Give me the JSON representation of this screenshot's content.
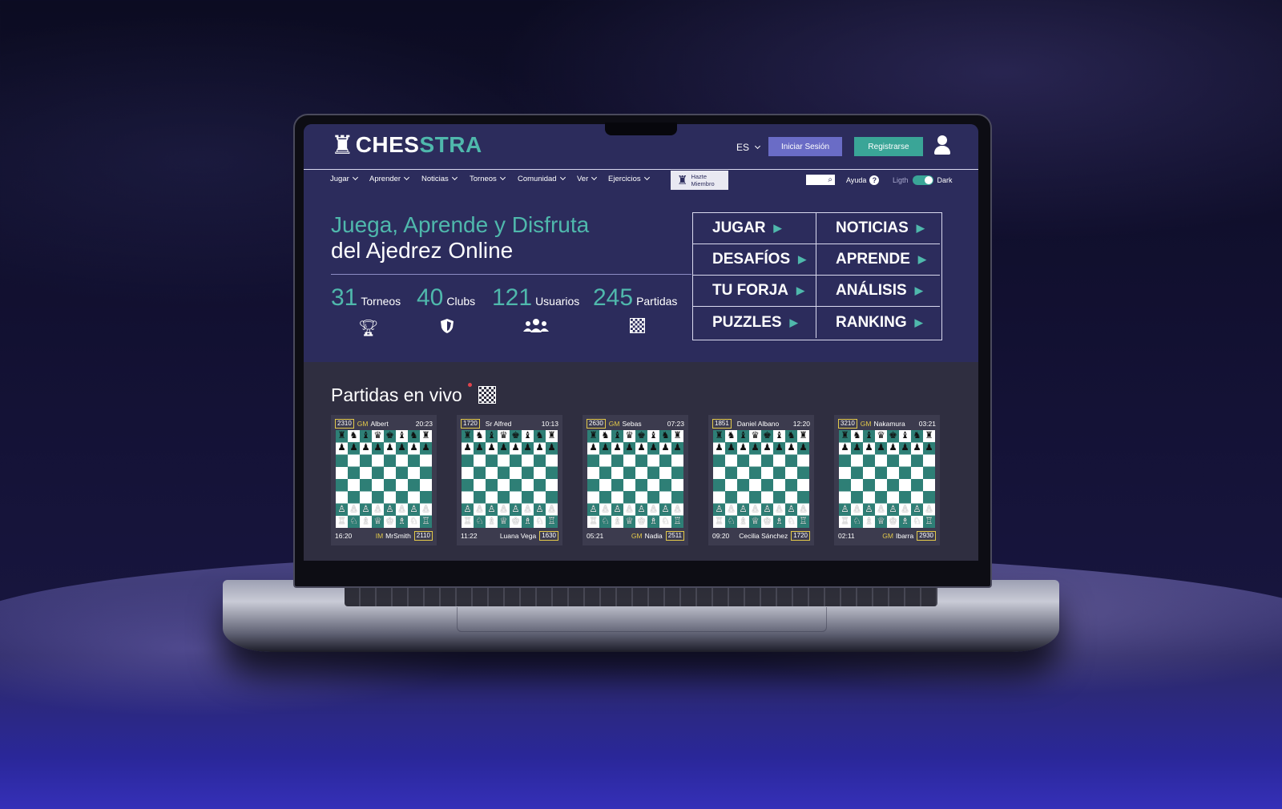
{
  "brand": {
    "part1": "CHES",
    "part2": "STRA"
  },
  "header": {
    "language": "ES",
    "login_label": "Iniciar Sesión",
    "register_label": "Registrarse"
  },
  "nav": {
    "items": [
      {
        "label": "Jugar"
      },
      {
        "label": "Aprender"
      },
      {
        "label": "Noticias"
      },
      {
        "label": "Torneos"
      },
      {
        "label": "Comunidad"
      },
      {
        "label": "Ver"
      },
      {
        "label": "Ejercicios"
      }
    ],
    "member_line1": "Hazte",
    "member_line2": "Miembro",
    "help_label": "Ayuda",
    "theme_light": "Ligth",
    "theme_dark": "Dark",
    "dark_mode_on": true
  },
  "hero": {
    "title_line1": "Juega, Aprende y Disfruta",
    "title_line2": "del Ajedrez Online",
    "stats": [
      {
        "value": "31",
        "label": "Torneos",
        "icon": "trophy-icon"
      },
      {
        "value": "40",
        "label": "Clubs",
        "icon": "shield-icon"
      },
      {
        "value": "121",
        "label": "Usuarios",
        "icon": "users-icon"
      },
      {
        "value": "245",
        "label": "Partidas",
        "icon": "checkered-flag-icon"
      }
    ],
    "menu": [
      {
        "label": "JUGAR"
      },
      {
        "label": "NOTICIAS"
      },
      {
        "label": "DESAFÍOS"
      },
      {
        "label": "APRENDE"
      },
      {
        "label": "TU FORJA"
      },
      {
        "label": "ANÁLISIS"
      },
      {
        "label": "PUZZLES"
      },
      {
        "label": "RANKING"
      }
    ]
  },
  "live": {
    "title": "Partidas en vivo",
    "games": [
      {
        "top_elo": "2310",
        "top_title": "GM",
        "top_name": "Albert",
        "top_time": "20:23",
        "bottom_time": "16:20",
        "bottom_title": "IM",
        "bottom_name": "MrSmith",
        "bottom_elo": "2110"
      },
      {
        "top_elo": "1720",
        "top_title": "",
        "top_name": "Sr Alfred",
        "top_time": "10:13",
        "bottom_time": "11:22",
        "bottom_title": "",
        "bottom_name": "Luana Vega",
        "bottom_elo": "1630"
      },
      {
        "top_elo": "2630",
        "top_title": "GM",
        "top_name": "Sebas",
        "top_time": "07:23",
        "bottom_time": "05:21",
        "bottom_title": "GM",
        "bottom_name": "Nadia",
        "bottom_elo": "2511"
      },
      {
        "top_elo": "1851",
        "top_title": "",
        "top_name": "Daniel Albano",
        "top_time": "12:20",
        "bottom_time": "09:20",
        "bottom_title": "",
        "bottom_name": "Cecilia Sánchez",
        "bottom_elo": "1720"
      },
      {
        "top_elo": "3210",
        "top_title": "GM",
        "top_name": "Nakamura",
        "top_time": "03:21",
        "bottom_time": "02:11",
        "bottom_title": "GM",
        "bottom_name": "Ibarra",
        "bottom_elo": "2930"
      }
    ]
  },
  "colors": {
    "accent": "#4fb8ac",
    "primary_bg": "#2c2c5c",
    "login_button": "#6a6cc6",
    "register_button": "#3aa597",
    "board_dark": "#2e7f76",
    "elo_border": "#e3c94a"
  }
}
